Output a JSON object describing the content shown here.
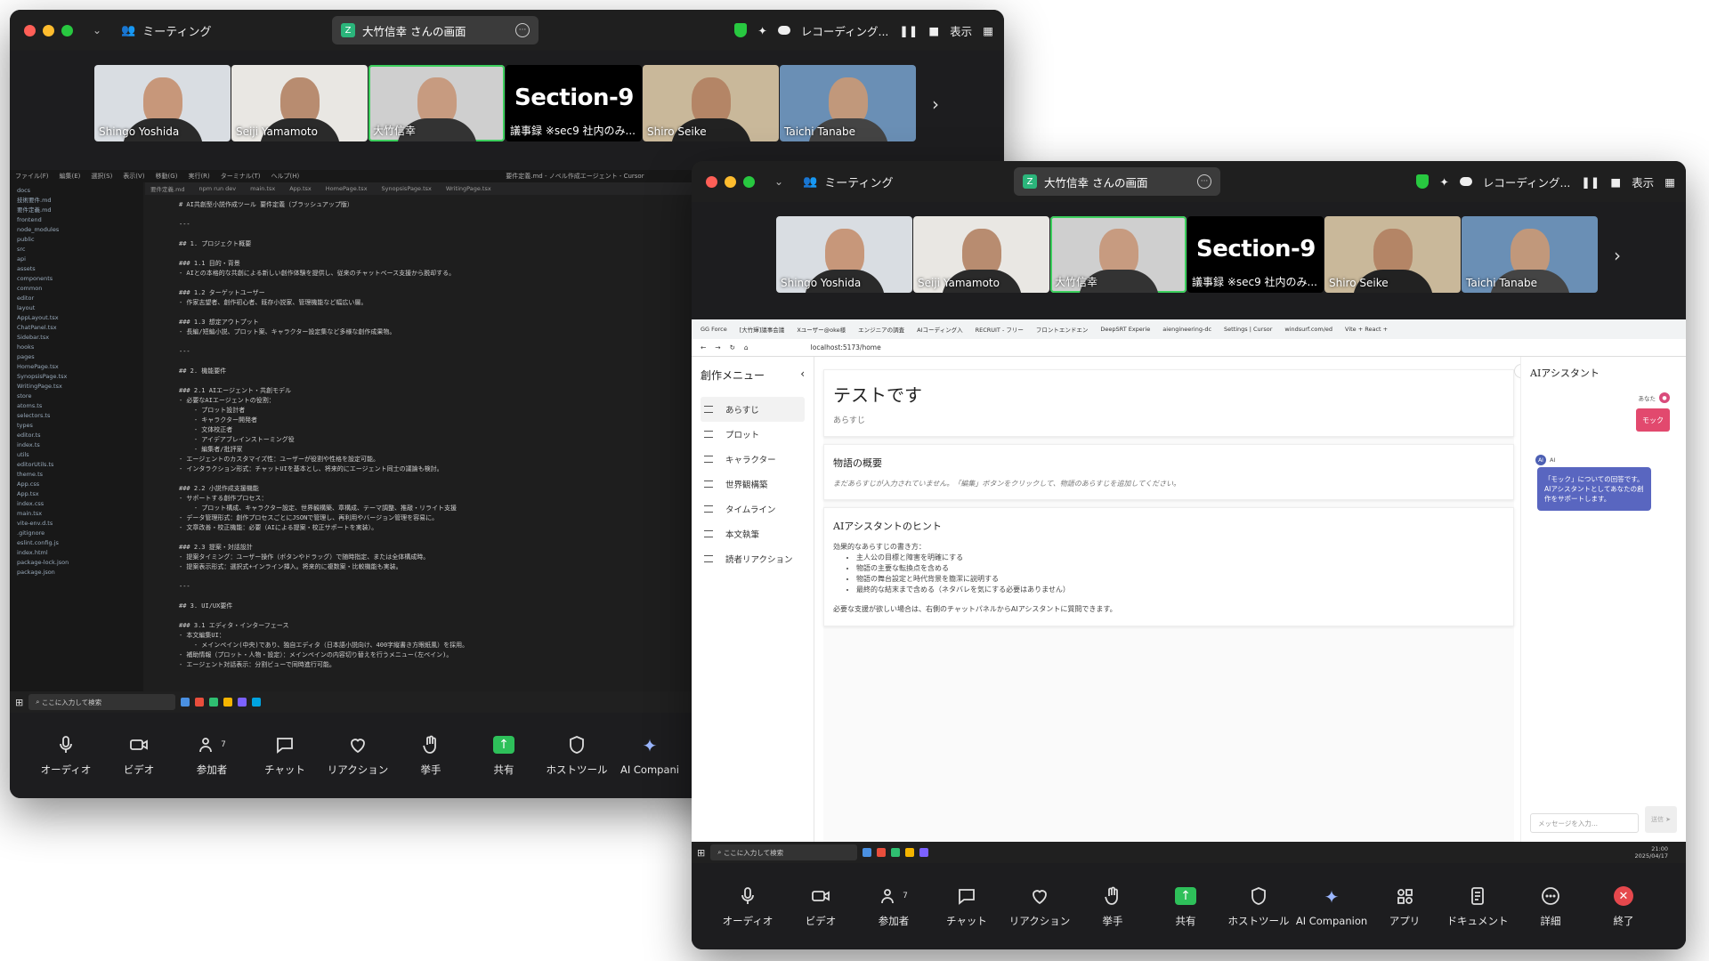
{
  "zoom": {
    "meeting_label": "ミーティング",
    "share_label": "大竹信幸 さんの画面",
    "recording_label": "レコーディング...",
    "view_label": "表示",
    "participants": [
      {
        "name": "Shingo Yoshida"
      },
      {
        "name": "Seiji Yamamoto"
      },
      {
        "name": "大竹信幸",
        "active": true
      },
      {
        "name": "議事録 ※sec9 社内のみ...",
        "logo": "Section-9"
      },
      {
        "name": "Shiro Seike"
      },
      {
        "name": "Taichi Tanabe"
      }
    ],
    "toolbar_a": [
      "オーディオ",
      "ビデオ",
      "参加者",
      "チャット",
      "リアクション",
      "挙手",
      "共有",
      "ホストツール",
      "AI Compani"
    ],
    "toolbar_b": [
      "オーディオ",
      "ビデオ",
      "参加者",
      "チャット",
      "リアクション",
      "挙手",
      "共有",
      "ホストツール",
      "AI Companion",
      "アプリ",
      "ドキュメント",
      "詳細",
      "終了"
    ],
    "participant_count": "7"
  },
  "editor": {
    "menu": [
      "ファイル(F)",
      "編集(E)",
      "選択(S)",
      "表示(V)",
      "移動(G)",
      "実行(R)",
      "ターミナル(T)",
      "ヘルプ(H)"
    ],
    "window_title": "要件定義.md - ノベル作成エージェント - Cursor",
    "tabs": [
      "要件定義.md",
      "npm run dev",
      "main.tsx",
      "App.tsx",
      "HomePage.tsx",
      "SynopsisPage.tsx",
      "WritingPage.tsx"
    ],
    "files": [
      "docs",
      "技術要件.md",
      "要件定義.md",
      "frontend",
      "node_modules",
      "public",
      "src",
      "api",
      "assets",
      "components",
      "common",
      "editor",
      "layout",
      "AppLayout.tsx",
      "ChatPanel.tsx",
      "Sidebar.tsx",
      "hooks",
      "pages",
      "HomePage.tsx",
      "SynopsisPage.tsx",
      "WritingPage.tsx",
      "store",
      "atoms.ts",
      "selectors.ts",
      "types",
      "editor.ts",
      "index.ts",
      "utils",
      "editorUtils.ts",
      "theme.ts",
      "App.css",
      "App.tsx",
      "index.css",
      "main.tsx",
      "vite-env.d.ts",
      ".gitignore",
      "eslint.config.js",
      "index.html",
      "package-lock.json",
      "package.json"
    ],
    "code": "# AI共創型小説作成ツール 要件定義（ブラッシュアップ版）\n\n---\n\n## 1. プロジェクト概要\n\n### 1.1 目的・背景\n- AIとの本格的な共創による新しい創作体験を提供し、従来のチャットベース支援から脱却する。\n\n### 1.2 ターゲットユーザー\n- 作家志望者、創作初心者、既存小説家、管理機能など幅広い層。\n\n### 1.3 想定アウトプット\n- 長編/短編小説、プロット案、キャラクター設定集など多様な創作成果物。\n\n---\n\n## 2. 機能要件\n\n### 2.1 AIエージェント・共創モデル\n- 必要なAIエージェントの役割：\n    - プロット設計者\n    - キャラクター開発者\n    - 文体校正者\n    - アイデアブレインストーミング役\n    - 編集者/批評家\n- エージェントのカスタマイズ性：ユーザーが役割や性格を設定可能。\n- インタラクション形式：チャットUIを基本とし、将来的にエージェント同士の議論も検討。\n\n### 2.2 小説作成支援機能\n- サポートする創作プロセス：\n    - プロット構成、キャラクター設定、世界観構築、章構成、テーマ調整、推敲・リライト支援\n- データ管理形式：創作プロセスごとにJSONで管理し、再利用やバージョン管理を容易に。\n- 文章改善・校正機能：必要（AIによる提案・校正サポートを実装）。\n\n### 2.3 提案・対話設計\n- 提案タイミング：ユーザー操作（ボタンやドラッグ）で随時指定、または全体構成時。\n- 提案表示形式：選択式+インライン挿入。将来的に複数案・比較機能も実装。\n\n---\n\n## 3. UI/UX要件\n\n### 3.1 エディタ・インターフェース\n- 本文編集UI：\n    - メインペイン(中央)であり、独自エディタ（日本語小説向け、400字縦書き方眼紙風）を採用。\n- 補助情報（プロット・人物・設定）：メインペインの内容切り替えを行うメニュー(左ペイン)。\n- エージェント対話表示：分割ビューで同時進行可能。",
    "search_placeholder": "ここに入力して検索"
  },
  "browser": {
    "tabs": [
      "GG Force",
      "[大竹輝]議事会議",
      "Xユーザー@oke様",
      "エンジニアの調査",
      "AIコーディング入",
      "RECRUIT - フリー",
      "フロントエンドエン",
      "DeepSRT Experie",
      "aiengineering-dc",
      "Settings | Cursor",
      "windsurf.com/ed",
      "Vite + React +"
    ],
    "url": "localhost:5173/home"
  },
  "app": {
    "sidebar_title": "創作メニュー",
    "menu": [
      "あらすじ",
      "プロット",
      "キャラクター",
      "世界観構築",
      "タイムライン",
      "本文執筆",
      "読者リアクション"
    ],
    "page_title": "テストです",
    "page_subtitle": "あらすじ",
    "overview_title": "物語の概要",
    "overview_empty": "まだあらすじが入力されていません。「編集」ボタンをクリックして、物語のあらすじを追加してください。",
    "hint_title": "AIアシスタントのヒント",
    "hint_lead": "効果的なあらすじの書き方：",
    "hint_items": [
      "主人公の目標と障害を明確にする",
      "物語の主要な転換点を含める",
      "物語の舞台設定と時代背景を簡潔に説明する",
      "最終的な結末まで含める（ネタバレを気にする必要はありません）"
    ],
    "hint_footer": "必要な支援が欲しい場合は、右側のチャットパネルからAIアシスタントに質問できます。",
    "ai_title": "AIアシスタント",
    "you_label": "あなた",
    "user_message": "モック",
    "ai_label": "AI",
    "ai_message": "「モック」についての回答です。AIアシスタントとしてあなたの創作をサポートします。",
    "input_placeholder": "メッセージを入力...",
    "send_label": "送信"
  },
  "taskbar": {
    "search_placeholder": "ここに入力して検索",
    "time": "21:00",
    "date": "2025/04/17"
  }
}
